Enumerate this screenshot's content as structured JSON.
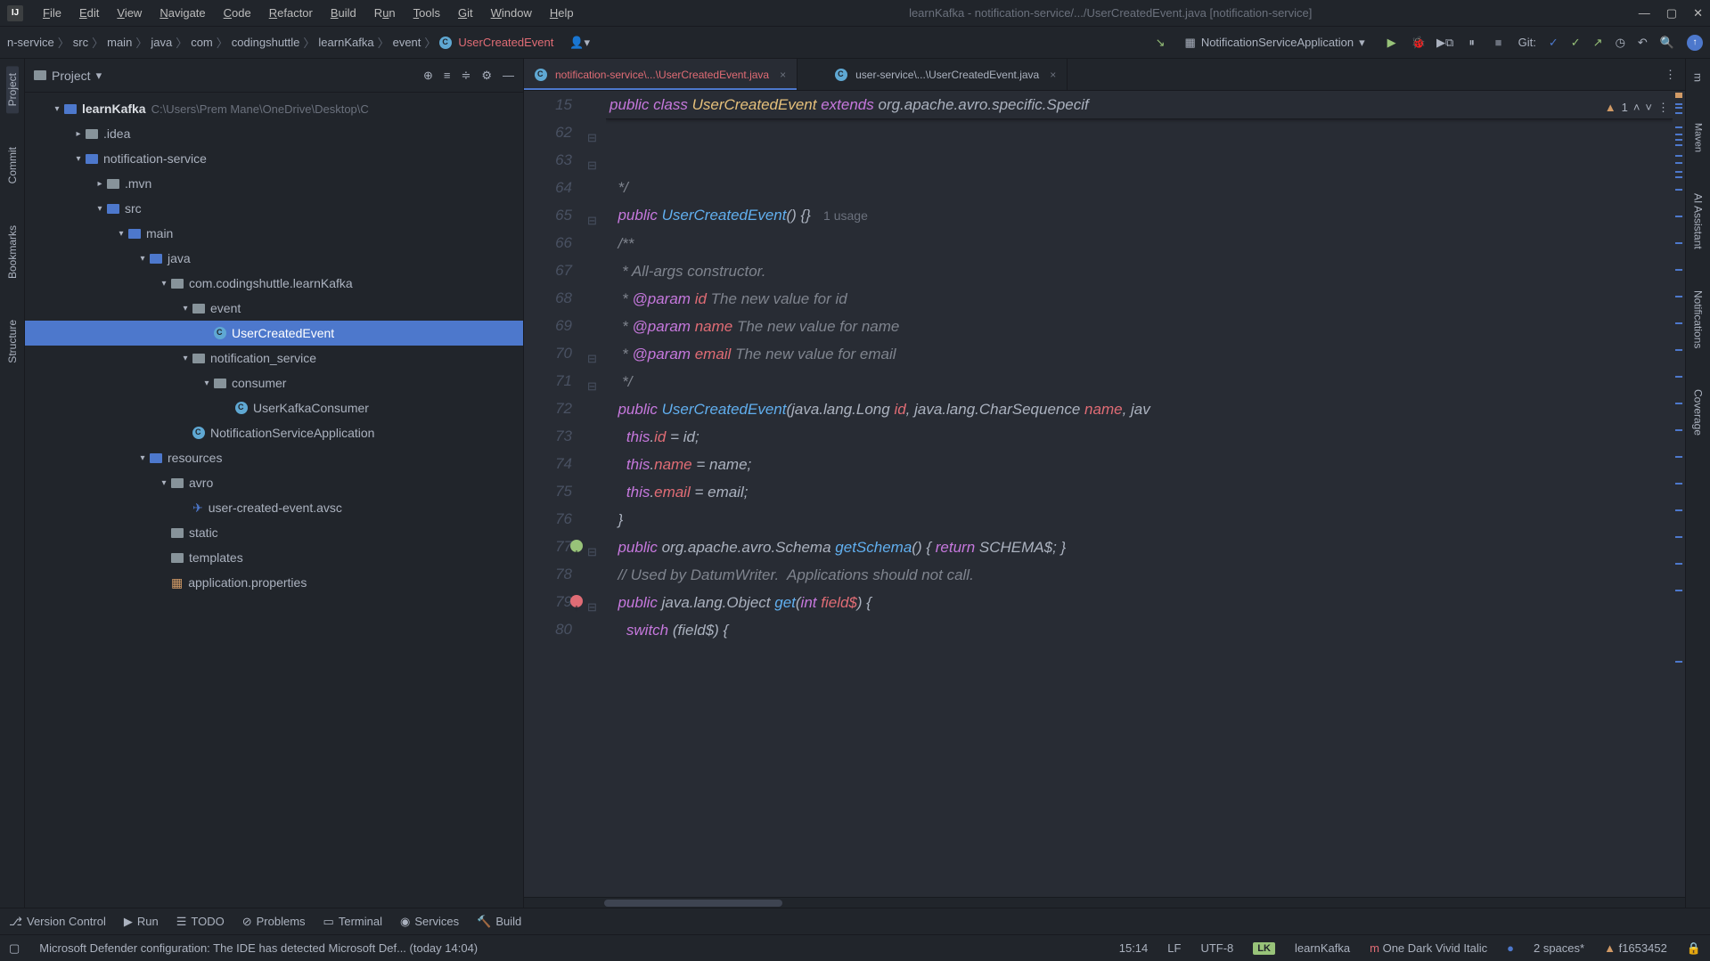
{
  "titlebar": {
    "menus": [
      "File",
      "Edit",
      "View",
      "Navigate",
      "Code",
      "Refactor",
      "Build",
      "Run",
      "Tools",
      "Git",
      "Window",
      "Help"
    ],
    "title": "learnKafka - notification-service/.../UserCreatedEvent.java [notification-service]"
  },
  "breadcrumb": {
    "items": [
      "n-service",
      "src",
      "main",
      "java",
      "com",
      "codingshuttle",
      "learnKafka",
      "event"
    ],
    "last": "UserCreatedEvent"
  },
  "runConfig": "NotificationServiceApplication",
  "gitLabel": "Git:",
  "leftTools": [
    "Project",
    "Commit",
    "Bookmarks",
    "Structure"
  ],
  "rightTools": [
    "Maven",
    "AI Assistant",
    "Notifications",
    "Coverage"
  ],
  "projectPanel": {
    "title": "Project",
    "root": {
      "label": "learnKafka",
      "path": "C:\\Users\\Prem Mane\\OneDrive\\Desktop\\C"
    },
    "tree": [
      {
        "indent": 1,
        "arrow": "▸",
        "icon": "folder",
        "label": ".idea"
      },
      {
        "indent": 1,
        "arrow": "▾",
        "icon": "folder-blue",
        "label": "notification-service"
      },
      {
        "indent": 2,
        "arrow": "▸",
        "icon": "folder",
        "label": ".mvn"
      },
      {
        "indent": 2,
        "arrow": "▾",
        "icon": "folder-blue",
        "label": "src"
      },
      {
        "indent": 3,
        "arrow": "▾",
        "icon": "folder-blue",
        "label": "main"
      },
      {
        "indent": 4,
        "arrow": "▾",
        "icon": "folder-blue",
        "label": "java"
      },
      {
        "indent": 5,
        "arrow": "▾",
        "icon": "folder",
        "label": "com.codingshuttle.learnKafka"
      },
      {
        "indent": 6,
        "arrow": "▾",
        "icon": "folder",
        "label": "event"
      },
      {
        "indent": 7,
        "arrow": "",
        "icon": "class",
        "label": "UserCreatedEvent",
        "selected": true
      },
      {
        "indent": 6,
        "arrow": "▾",
        "icon": "folder",
        "label": "notification_service"
      },
      {
        "indent": 7,
        "arrow": "▾",
        "icon": "folder",
        "label": "consumer"
      },
      {
        "indent": 8,
        "arrow": "",
        "icon": "class",
        "label": "UserKafkaConsumer"
      },
      {
        "indent": 6,
        "arrow": "",
        "icon": "class",
        "label": "NotificationServiceApplication"
      },
      {
        "indent": 4,
        "arrow": "▾",
        "icon": "folder-blue",
        "label": "resources"
      },
      {
        "indent": 5,
        "arrow": "▾",
        "icon": "folder",
        "label": "avro"
      },
      {
        "indent": 6,
        "arrow": "",
        "icon": "avro",
        "label": "user-created-event.avsc"
      },
      {
        "indent": 5,
        "arrow": "",
        "icon": "folder",
        "label": "static"
      },
      {
        "indent": 5,
        "arrow": "",
        "icon": "folder",
        "label": "templates"
      },
      {
        "indent": 5,
        "arrow": "",
        "icon": "props",
        "label": "application.properties"
      }
    ]
  },
  "tabs": [
    {
      "label": "notification-service\\...\\UserCreatedEvent.java",
      "active": true
    },
    {
      "label": "user-service\\...\\UserCreatedEvent.java",
      "active": false
    }
  ],
  "editor": {
    "stickyLine": 15,
    "warnCount": 1,
    "lines": [
      62,
      63,
      64,
      65,
      66,
      67,
      68,
      69,
      70,
      71,
      72,
      73,
      74,
      75,
      76,
      77,
      78,
      79,
      80
    ],
    "usageHint": "1 usage"
  },
  "bottomTools": [
    "Version Control",
    "Run",
    "TODO",
    "Problems",
    "Terminal",
    "Services",
    "Build"
  ],
  "statusbar": {
    "message": "Microsoft Defender configuration: The IDE has detected Microsoft Def... (today 14:04)",
    "cursor": "15:14",
    "lineSep": "LF",
    "encoding": "UTF-8",
    "badge": "LK",
    "project": "learnKafka",
    "theme": "One Dark Vivid Italic",
    "indent": "2 spaces*",
    "revision": "f1653452"
  }
}
